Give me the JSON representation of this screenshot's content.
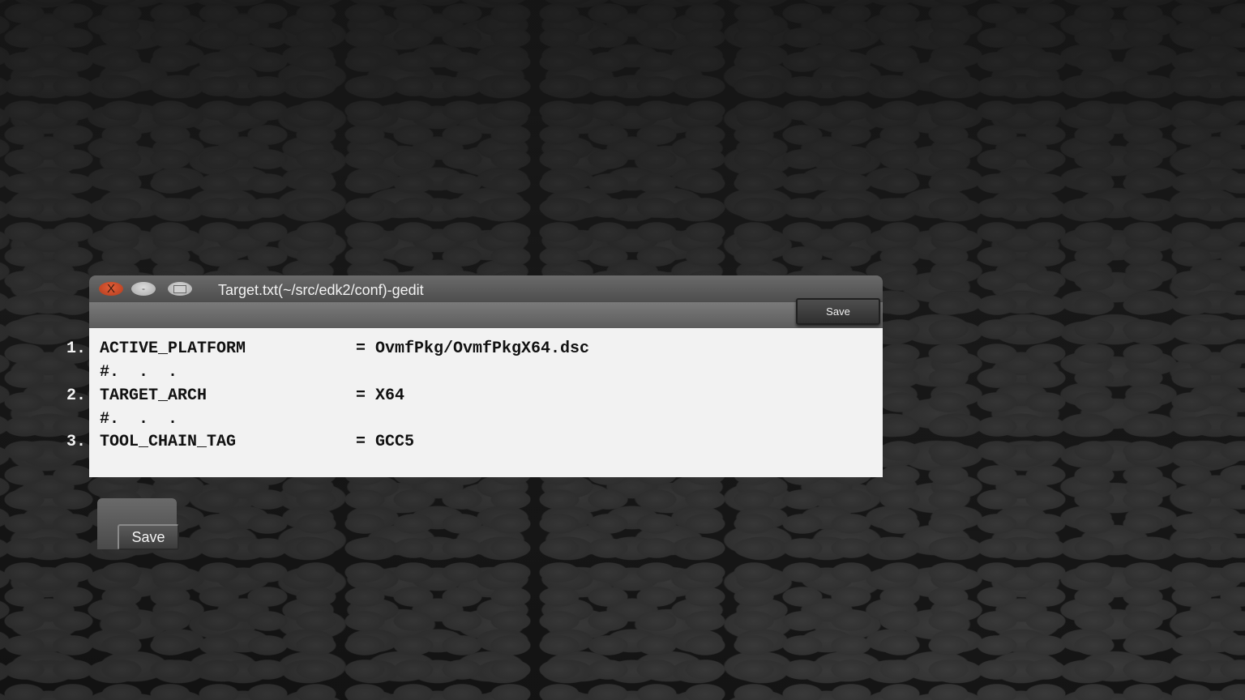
{
  "window": {
    "title": "Target.txt(~/src/edk2/conf)-gedit",
    "close_label": "X",
    "minimize_label": "-",
    "toolbar_save_label": "Save"
  },
  "editor": {
    "lines": [
      {
        "number": "1.",
        "key": "ACTIVE_PLATFORM",
        "value": "= OvmfPkg/OvmfPkgX64.dsc"
      },
      {
        "comment": "#.  .  ."
      },
      {
        "number": "2.",
        "key": "TARGET_ARCH",
        "value": "= X64"
      },
      {
        "comment": "#.  .  ."
      },
      {
        "number": "3.",
        "key": "TOOL_CHAIN_TAG",
        "value": "= GCC5"
      }
    ]
  },
  "save_button": {
    "label": "Save"
  },
  "colors": {
    "close_button": "#c4452a",
    "editor_background": "#f2f2f2",
    "titlebar": "#5a5a5a"
  },
  "icons": [
    "close-icon",
    "minimize-icon",
    "maximize-icon"
  ]
}
